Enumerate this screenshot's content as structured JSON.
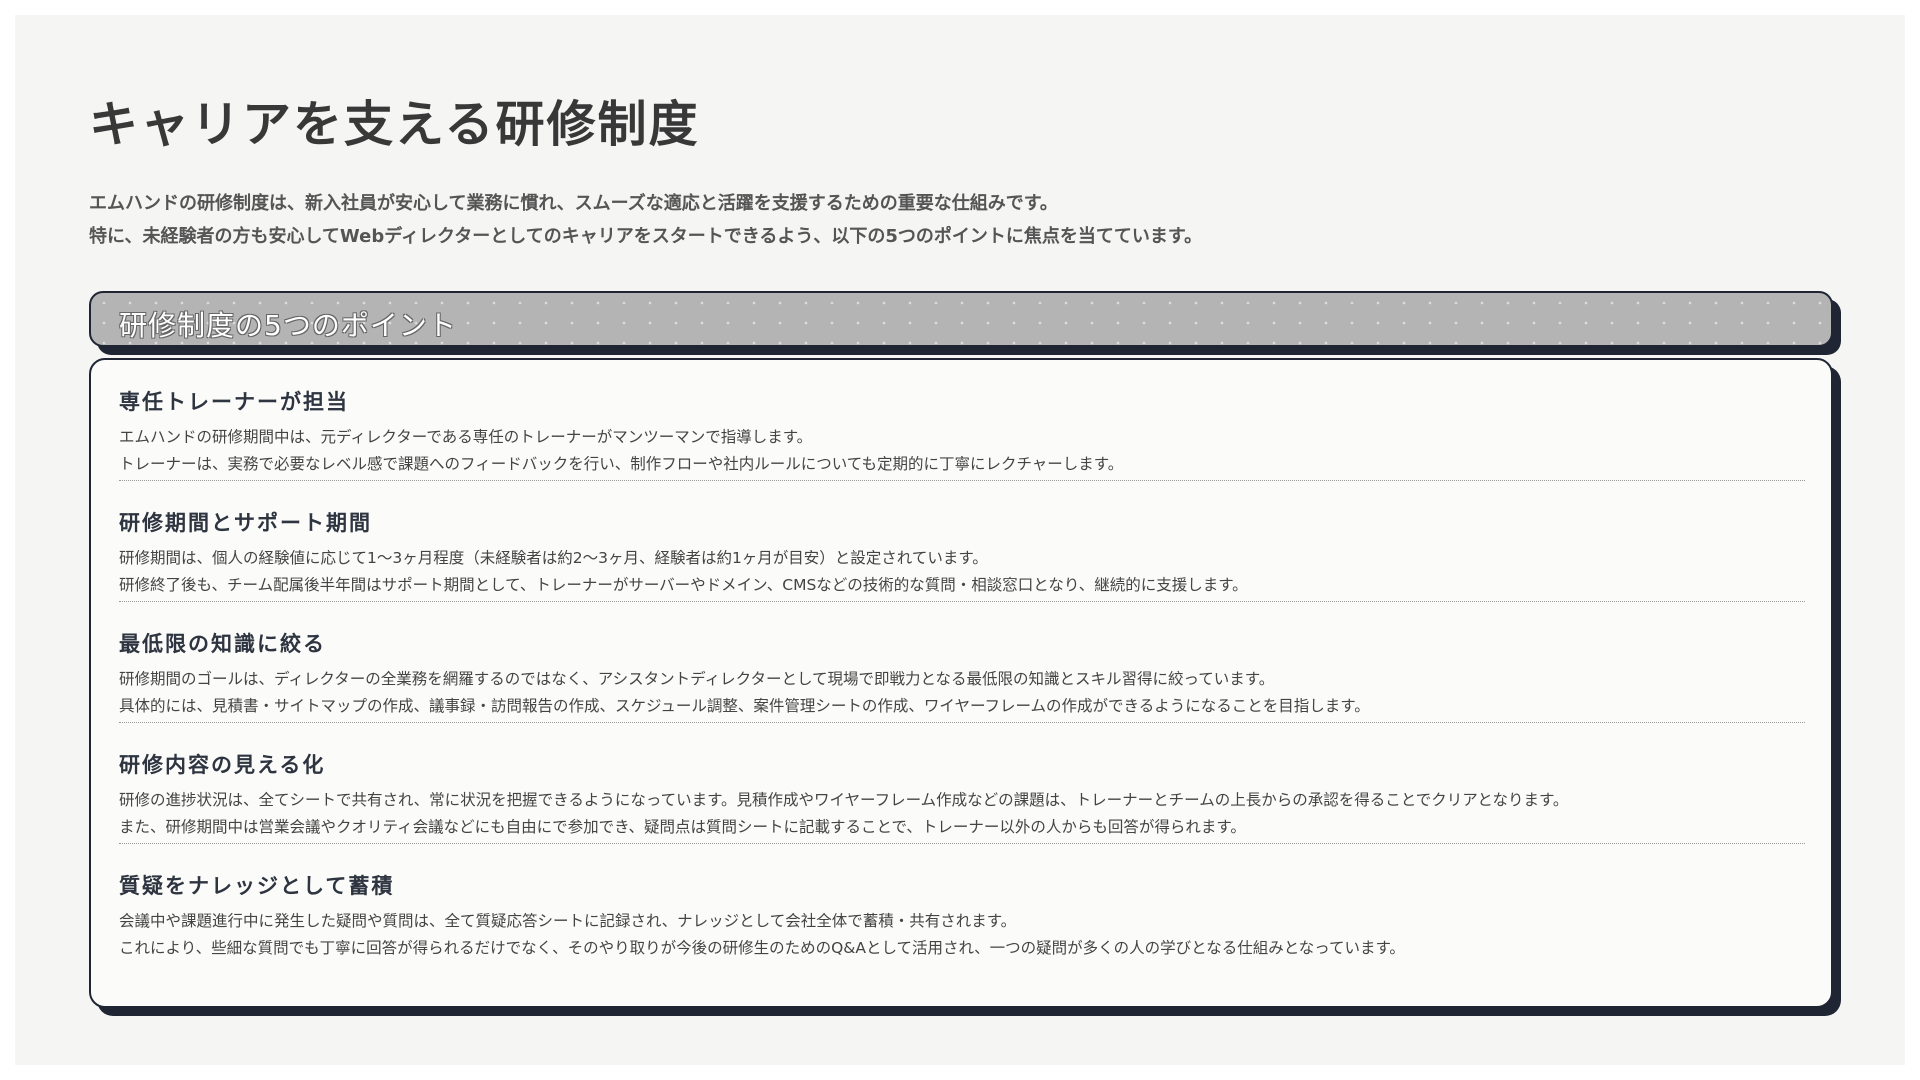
{
  "page": {
    "title": "キャリアを支える研修制度",
    "intro": [
      "エムハンドの研修制度は、新入社員が安心して業務に慣れ、スムーズな適応と活躍を支援するための重要な仕組みです。",
      "特に、未経験者の方も安心してWebディレクターとしてのキャリアをスタートできるよう、以下の5つのポイントに焦点を当てています。"
    ]
  },
  "section": {
    "title": "研修制度の5つのポイント",
    "points": [
      {
        "title": "専任トレーナーが担当",
        "lines": [
          "エムハンドの研修期間中は、元ディレクターである専任のトレーナーがマンツーマンで指導します。",
          "トレーナーは、実務で必要なレベル感で課題へのフィードバックを行い、制作フローや社内ルールについても定期的に丁寧にレクチャーします。"
        ]
      },
      {
        "title": "研修期間とサポート期間",
        "lines": [
          "研修期間は、個人の経験値に応じて1〜3ヶ月程度（未経験者は約2〜3ヶ月、経験者は約1ヶ月が目安）と設定されています。",
          "研修終了後も、チーム配属後半年間はサポート期間として、トレーナーがサーバーやドメイン、CMSなどの技術的な質問・相談窓口となり、継続的に支援します。"
        ]
      },
      {
        "title": "最低限の知識に絞る",
        "lines": [
          "研修期間のゴールは、ディレクターの全業務を網羅するのではなく、アシスタントディレクターとして現場で即戦力となる最低限の知識とスキル習得に絞っています。",
          "具体的には、見積書・サイトマップの作成、議事録・訪問報告の作成、スケジュール調整、案件管理シートの作成、ワイヤーフレームの作成ができるようになることを目指します。"
        ]
      },
      {
        "title": "研修内容の見える化",
        "lines": [
          "研修の進捗状況は、全てシートで共有され、常に状況を把握できるようになっています。見積作成やワイヤーフレーム作成などの課題は、トレーナーとチームの上長からの承認を得ることでクリアとなります。",
          "また、研修期間中は営業会議やクオリティ会議などにも自由にで参加でき、疑問点は質問シートに記載することで、トレーナー以外の人からも回答が得られます。"
        ]
      },
      {
        "title": "質疑をナレッジとして蓄積",
        "lines": [
          "会議中や課題進行中に発生した疑問や質問は、全て質疑応答シートに記録され、ナレッジとして会社全体で蓄積・共有されます。",
          "これにより、些細な質問でも丁寧に回答が得られるだけでなく、そのやり取りが今後の研修生のためのQ&Aとして活用され、一つの疑問が多くの人の学びとなる仕組みとなっています。"
        ]
      }
    ]
  },
  "colors": {
    "background": "#f5f5f4",
    "card": "#fbfcfa",
    "border_shadow": "#1f2533",
    "header_band": "#b4b4b4"
  }
}
